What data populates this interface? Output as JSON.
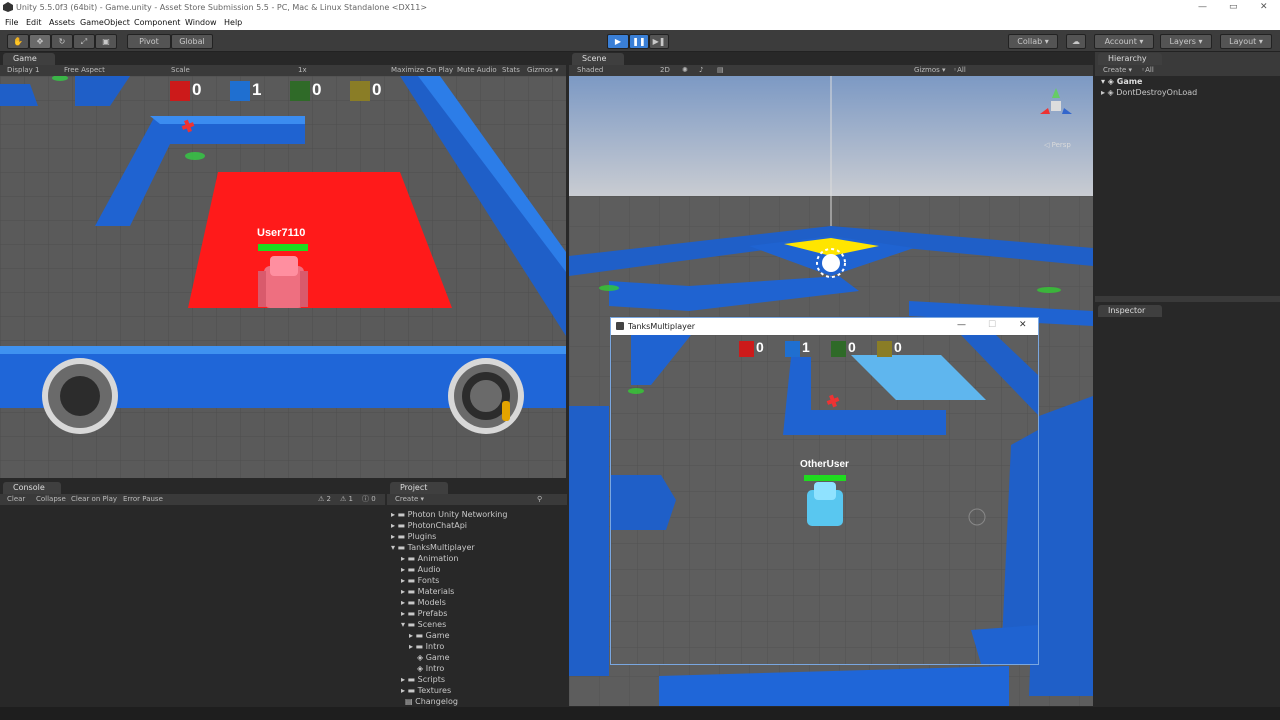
{
  "window": {
    "title": "Unity 5.5.0f3 (64bit) - Game.unity - Asset Store Submission 5.5 - PC, Mac & Linux Standalone <DX11>",
    "min": "—",
    "restore": "▭",
    "close": "✕"
  },
  "menu": [
    "File",
    "Edit",
    "Assets",
    "GameObject",
    "Component",
    "Window",
    "Help"
  ],
  "toolbar": {
    "pivot": "Pivot",
    "global": "Global",
    "collab": "Collab ▾",
    "account": "Account ▾",
    "layers": "Layers ▾",
    "layout": "Layout ▾"
  },
  "game": {
    "tab": "Game",
    "display": "Display 1",
    "aspect": "Free Aspect",
    "scale": "Scale",
    "scale_value": "1x",
    "maximize": "Maximize On Play",
    "mute": "Mute Audio",
    "stats": "Stats",
    "gizmos": "Gizmos ▾",
    "player": "User7110",
    "scores": [
      {
        "color": "#cc1a1a",
        "value": "0"
      },
      {
        "color": "#1f6fd0",
        "value": "1"
      },
      {
        "color": "#2f6a28",
        "value": "0"
      },
      {
        "color": "#8a7d26",
        "value": "0"
      }
    ]
  },
  "scene": {
    "tab": "Scene",
    "shaded": "Shaded",
    "mode2d": "2D",
    "gizmos": "Gizmos ▾",
    "search": "◦All",
    "persp": "◁ Persp"
  },
  "hierarchy": {
    "tab": "Hierarchy",
    "create": "Create ▾",
    "search": "◦All",
    "items": [
      "Game",
      "DontDestroyOnLoad"
    ]
  },
  "inspector": {
    "tab": "Inspector"
  },
  "console": {
    "tab": "Console",
    "buttons": [
      "Clear",
      "Collapse",
      "Clear on Play",
      "Error Pause"
    ],
    "warn_count": "2",
    "err_count": "1",
    "info_count": "0"
  },
  "project": {
    "tab": "Project",
    "create": "Create ▾",
    "items": [
      "Photon Unity Networking",
      "PhotonChatApi",
      "Plugins",
      "TanksMultiplayer",
      "Animation",
      "Audio",
      "Fonts",
      "Materials",
      "Models",
      "Prefabs",
      "Scenes",
      "Game",
      "Intro",
      "Game",
      "Intro",
      "Scripts",
      "Textures",
      "Changelog"
    ]
  },
  "popup": {
    "title": "TanksMultiplayer",
    "player": "OtherUser",
    "scores": [
      {
        "color": "#cc1a1a",
        "value": "0"
      },
      {
        "color": "#1f6fd0",
        "value": "1"
      },
      {
        "color": "#2f6a28",
        "value": "0"
      },
      {
        "color": "#8a7d26",
        "value": "0"
      }
    ],
    "min": "—",
    "max": "☐",
    "close": "✕"
  }
}
